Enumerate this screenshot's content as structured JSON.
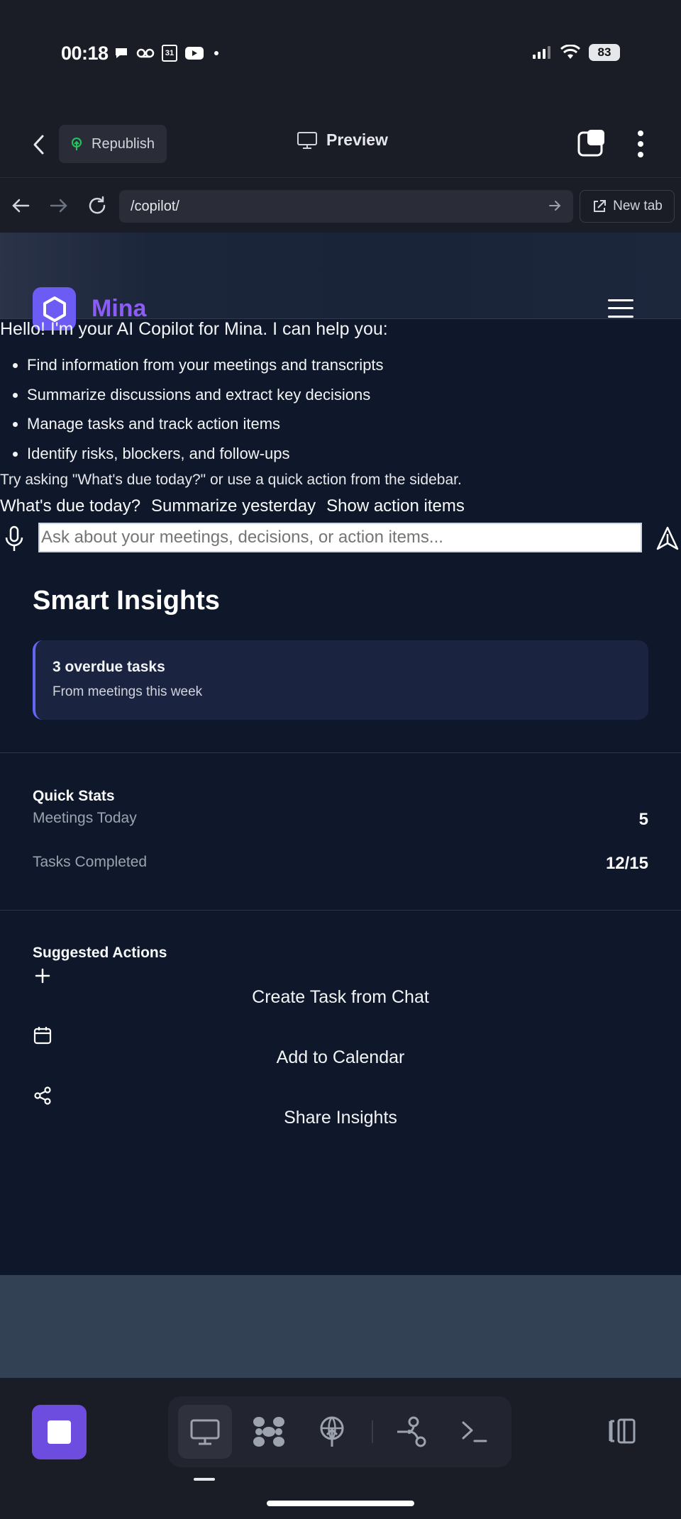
{
  "status_bar": {
    "time": "00:18",
    "battery": "83",
    "calendar_day": "31"
  },
  "app_header": {
    "republish_label": "Republish",
    "preview_label": "Preview"
  },
  "browser": {
    "url": "/copilot/",
    "new_tab_label": "New tab"
  },
  "site": {
    "brand": "Mina"
  },
  "chat": {
    "greeting": "Hello! I'm your AI Copilot for Mina. I can help you:",
    "capabilities": [
      "Find information from your meetings and transcripts",
      "Summarize discussions and extract key decisions",
      "Manage tasks and track action items",
      "Identify risks, blockers, and follow-ups"
    ],
    "hint": "Try asking \"What's due today?\" or use a quick action from the sidebar.",
    "quick_actions": [
      "What's due today?",
      "Summarize yesterday",
      "Show action items"
    ],
    "input_placeholder": "Ask about your meetings, decisions, or action items..."
  },
  "insights": {
    "title": "Smart Insights",
    "card_title": "3 overdue tasks",
    "card_subtitle": "From meetings this week"
  },
  "quick_stats": {
    "label": "Quick Stats",
    "rows": [
      {
        "label": "Meetings Today",
        "value": "5"
      },
      {
        "label": "Tasks Completed",
        "value": "12/15"
      }
    ]
  },
  "suggested_actions": {
    "label": "Suggested Actions",
    "items": [
      {
        "label": "Create Task from Chat",
        "icon": "plus-icon"
      },
      {
        "label": "Add to Calendar",
        "icon": "calendar-icon"
      },
      {
        "label": "Share Insights",
        "icon": "share-icon"
      }
    ]
  },
  "colors": {
    "accent": "#6d5cf4",
    "brand_text": "#8b5cf6",
    "page_bg": "#0f172a",
    "card_border": "#6366f1"
  }
}
